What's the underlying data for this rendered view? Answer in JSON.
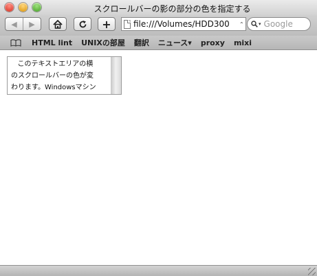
{
  "window": {
    "title": "スクロールバーの影の部分の色を指定する"
  },
  "toolbar": {
    "back_icon": "◀",
    "forward_icon": "▶",
    "home_icon": "⌂",
    "reload_icon": "↻",
    "add_bookmark_label": "+",
    "url": "file:///Volumes/HDD300",
    "url_stepper": "⌃",
    "search_placeholder": "Google"
  },
  "bookmarks": {
    "items": [
      "HTML lint",
      "UNIXの部屋",
      "翻訳",
      "ニュース▾",
      "proxy",
      "mixi"
    ]
  },
  "content": {
    "textarea_text": "   このテキストエリアの横\nのスクロールバーの色が変\nわります。Windowsマシン"
  }
}
